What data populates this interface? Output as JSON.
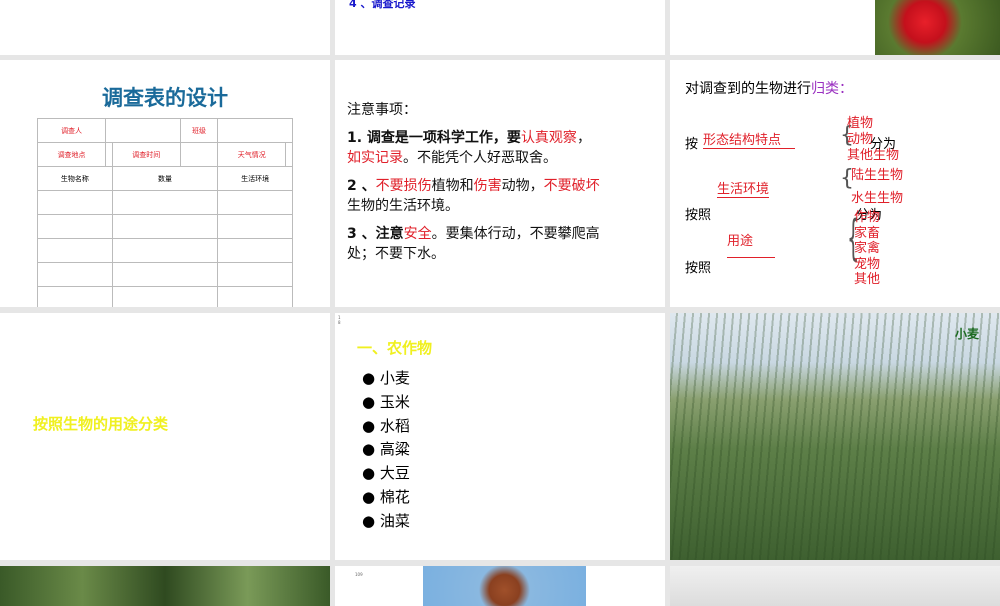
{
  "slide_top_middle": {
    "heading": "4 、调查记录"
  },
  "survey_table": {
    "title": "调查表的设计",
    "investigator": "调查人",
    "class": "班级",
    "location": "调查地点",
    "time": "调查时间",
    "weather": "天气情况",
    "col1": "生物名称",
    "col2": "数量",
    "col3": "生活环境"
  },
  "notes": {
    "heading": "注意事项：",
    "p1a": "1. 调查是一项科学工作，要",
    "p1b": "认真观察",
    "p1c": "，",
    "p1d": "如实记录",
    "p1e": "。不能凭个人好恶取舍。",
    "p2a": "2 、",
    "p2b": "不要损伤",
    "p2c": "植物和",
    "p2d": "伤害",
    "p2e": "动物，",
    "p2f": "不要破坏",
    "p2g": "生物的生活环境。",
    "p3a": "3 、注意",
    "p3b": "安全",
    "p3c": "。要集体行动，不要攀爬高处；不要下水。"
  },
  "classify": {
    "title_a": "对调查到的生物进行",
    "title_b": "归类：",
    "an": "按",
    "anzhao": "按照",
    "fenwei": "分为",
    "c1": "形态结构特点",
    "c1_items": [
      "植物",
      "动物",
      "其他生物"
    ],
    "c2": "生活环境",
    "c2_items": [
      "陆生生物",
      "水生生物"
    ],
    "c3": "用途",
    "c3_items": [
      "作物",
      "家畜",
      "家禽",
      "宠物",
      "其他"
    ]
  },
  "usage_slide": {
    "title": "按照生物的用途分类"
  },
  "crops": {
    "num": "1 8",
    "heading": "一、农作物",
    "items": [
      "小麦",
      "玉米",
      "水稻",
      "高粱",
      "大豆",
      "棉花",
      "油菜"
    ]
  },
  "wheat": {
    "label": "小麦"
  },
  "bottom": {
    "num": "109"
  }
}
